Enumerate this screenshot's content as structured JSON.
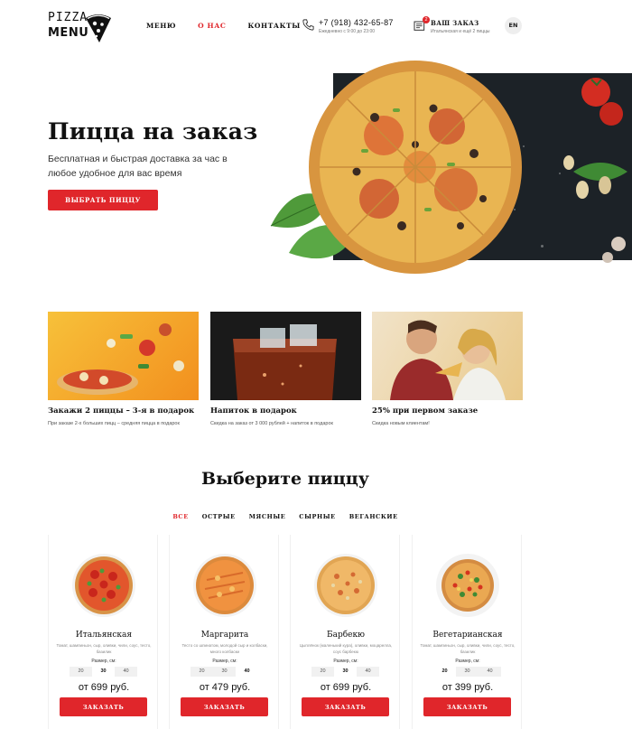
{
  "header": {
    "logo_line1": "PIZZA",
    "logo_line2": "MENU",
    "nav": [
      {
        "label": "МЕНЮ"
      },
      {
        "label": "О НАС"
      },
      {
        "label": "КОНТАКТЫ"
      }
    ],
    "phone": "+7 (918) 432-65-87",
    "phone_hours": "Ежедневно с 9:00 до 23:00",
    "order_label": "ВАШ ЗАКАЗ",
    "order_sub": "Итальянская и ещё 2 пиццы",
    "order_count": "2",
    "lang": "EN"
  },
  "hero": {
    "title": "Пицца на заказ",
    "subtitle": "Бесплатная и быстрая доставка за час в любое удобное для вас время",
    "button": "ВЫБРАТЬ ПИЦЦУ"
  },
  "promos": [
    {
      "title": "Закажи 2 пиццы – 3-я в подарок",
      "desc": "При заказе 2-х больших пицц – средняя пицца в подарок"
    },
    {
      "title": "Напиток в подарок",
      "desc": "Скидка на заказ от 3 000 рублей + напиток в подарок"
    },
    {
      "title": "25% при первом заказе",
      "desc": "Скидка новым клиентам!"
    }
  ],
  "section": {
    "title": "Выберите пиццу",
    "filters": [
      "ВСЕ",
      "ОСТРЫЕ",
      "МЯСНЫЕ",
      "СЫРНЫЕ",
      "ВЕГАНСКИЕ"
    ]
  },
  "products": [
    {
      "name": "Итальянская",
      "ingredients": "Томат, шампиньон, сыр, оливки, чили, соус, тесто, базилик",
      "size_label": "Размер, см:",
      "sizes": [
        "20",
        "30",
        "40"
      ],
      "price": "от 699 руб.",
      "button": "ЗАКАЗАТЬ"
    },
    {
      "name": "Маргарита",
      "ingredients": "Тесто со шпинатом, молодой сыр и колбаски, много колбаски",
      "size_label": "Размер, см:",
      "sizes": [
        "20",
        "30",
        "40"
      ],
      "price": "от 479 руб.",
      "button": "ЗАКАЗАТЬ"
    },
    {
      "name": "Барбекю",
      "ingredients": "Цыплёнок (маленький кура), оливки, моцарелла, соус барбекю",
      "size_label": "Размер, см:",
      "sizes": [
        "20",
        "30",
        "40"
      ],
      "price": "от 699 руб.",
      "button": "ЗАКАЗАТЬ"
    },
    {
      "name": "Вегетарианская",
      "ingredients": "Томат, шампиньон, сыр, оливки, чили, соус, тесто, базилик",
      "size_label": "Размер, см:",
      "sizes": [
        "20",
        "30",
        "40"
      ],
      "price": "от 399 руб.",
      "button": "ЗАКАЗАТЬ"
    }
  ],
  "colors": {
    "accent": "#e0262b",
    "board": "#1c2227"
  },
  "icons": [
    "phone-icon",
    "cart-icon",
    "pizza-slice-logo-icon"
  ]
}
